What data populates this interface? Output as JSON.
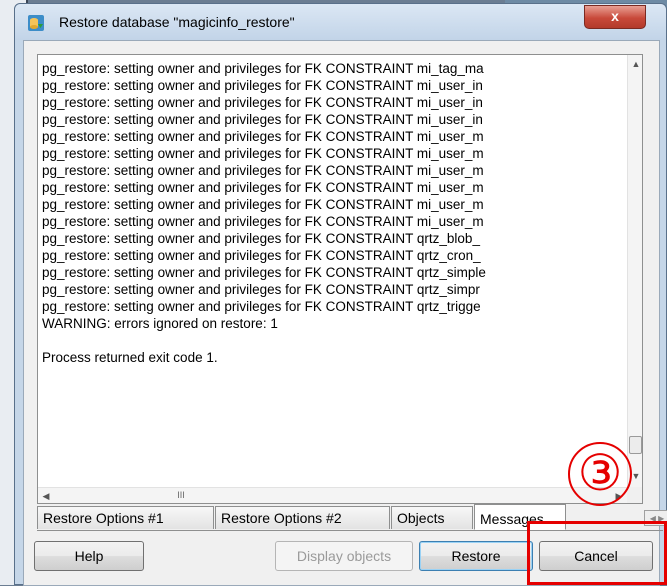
{
  "window": {
    "title": "Restore database \"magicinfo_restore\"",
    "close_glyph": "x",
    "icon": "database-restore-icon"
  },
  "log": {
    "lines": [
      "pg_restore: setting owner and privileges for FK CONSTRAINT mi_tag_ma",
      "pg_restore: setting owner and privileges for FK CONSTRAINT mi_user_in",
      "pg_restore: setting owner and privileges for FK CONSTRAINT mi_user_in",
      "pg_restore: setting owner and privileges for FK CONSTRAINT mi_user_in",
      "pg_restore: setting owner and privileges for FK CONSTRAINT mi_user_m",
      "pg_restore: setting owner and privileges for FK CONSTRAINT mi_user_m",
      "pg_restore: setting owner and privileges for FK CONSTRAINT mi_user_m",
      "pg_restore: setting owner and privileges for FK CONSTRAINT mi_user_m",
      "pg_restore: setting owner and privileges for FK CONSTRAINT mi_user_m",
      "pg_restore: setting owner and privileges for FK CONSTRAINT mi_user_m",
      "pg_restore: setting owner and privileges for FK CONSTRAINT qrtz_blob_",
      "pg_restore: setting owner and privileges for FK CONSTRAINT qrtz_cron_",
      "pg_restore: setting owner and privileges for FK CONSTRAINT qrtz_simple",
      "pg_restore: setting owner and privileges for FK CONSTRAINT qrtz_simpr",
      "pg_restore: setting owner and privileges for FK CONSTRAINT qrtz_trigge",
      "WARNING: errors ignored on restore: 1",
      "",
      "Process returned exit code 1."
    ]
  },
  "scrollbar": {
    "up_arrow": "▲",
    "down_arrow": "▼",
    "left_arrow": "◀",
    "right_arrow": "▶",
    "hthumb_grip": "III"
  },
  "tabs": [
    {
      "label": "Restore Options #1",
      "active": false
    },
    {
      "label": "Restore Options #2",
      "active": false
    },
    {
      "label": "Objects",
      "active": false
    },
    {
      "label": "Messages",
      "active": true
    }
  ],
  "tab_scroll": "◀ ▶",
  "buttons": {
    "help": "Help",
    "display_objects": "Display objects",
    "restore": "Restore",
    "cancel": "Cancel"
  },
  "annotation": {
    "step_marker": "③",
    "highlight_color": "#e50000"
  },
  "colors": {
    "title_bar": "#c2d4e8",
    "close_button": "#c8493a",
    "client_bg": "#f0f0f0"
  }
}
